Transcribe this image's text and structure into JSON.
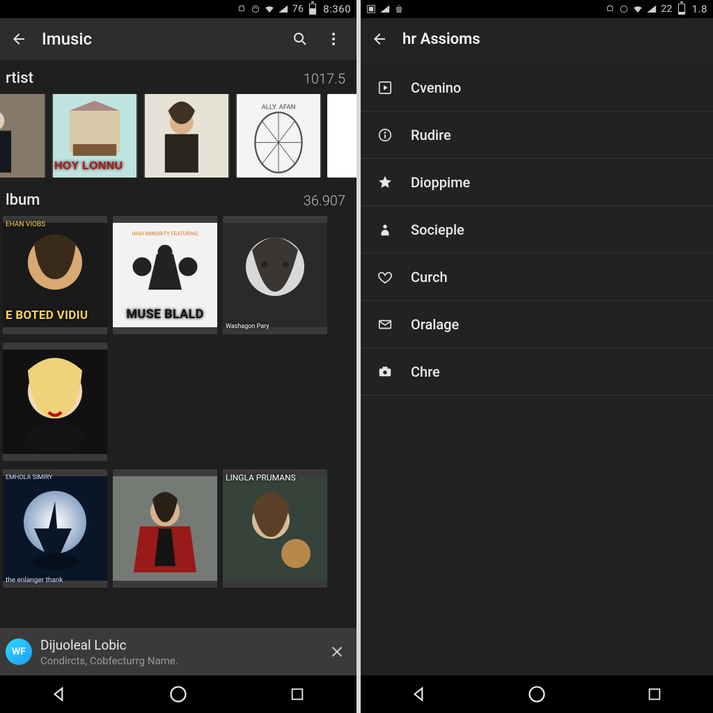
{
  "left": {
    "status": {
      "pct": "76",
      "clock": "8:360"
    },
    "appbar": {
      "title": "Imusic"
    },
    "sections": {
      "artist": {
        "label": "rtist",
        "count": "1017.5"
      },
      "album": {
        "label": "lbum",
        "count": "36.907"
      }
    },
    "artist_row": [
      {
        "caption": ""
      },
      {
        "caption": "HOY LONNU"
      },
      {
        "caption": ""
      },
      {
        "caption": "ALLY. AFAN"
      },
      {
        "caption": ""
      }
    ],
    "album_row1": [
      {
        "caption": "E BOTED VIDIU",
        "sub": "EHAN VIOBS"
      },
      {
        "caption": "MUSE BLALD"
      },
      {
        "caption": "",
        "sub": "Washagon Pary"
      }
    ],
    "album_row2": [
      {
        "caption": ""
      }
    ],
    "album_row3": [
      {
        "caption": "the enlanger thank",
        "sub": "EMHOLA SIMIRY"
      },
      {
        "caption": ""
      },
      {
        "caption": "LINGLA PRUMANS"
      }
    ],
    "now_playing": {
      "avatar": "WF",
      "title": "Dijuoleal Lobic",
      "subtitle": "Condircts, Cobfecturrg Name."
    }
  },
  "right": {
    "status": {
      "pct": "22",
      "clock": "1.8"
    },
    "appbar": {
      "title": "hr Assioms"
    },
    "menu": [
      {
        "icon": "play",
        "label": "Cvenino"
      },
      {
        "icon": "info",
        "label": "Rudire"
      },
      {
        "icon": "star",
        "label": "Dioppime"
      },
      {
        "icon": "person",
        "label": "Socieple"
      },
      {
        "icon": "heart",
        "label": "Curch"
      },
      {
        "icon": "mail",
        "label": "Oralage"
      },
      {
        "icon": "camera",
        "label": "Chre"
      }
    ]
  }
}
